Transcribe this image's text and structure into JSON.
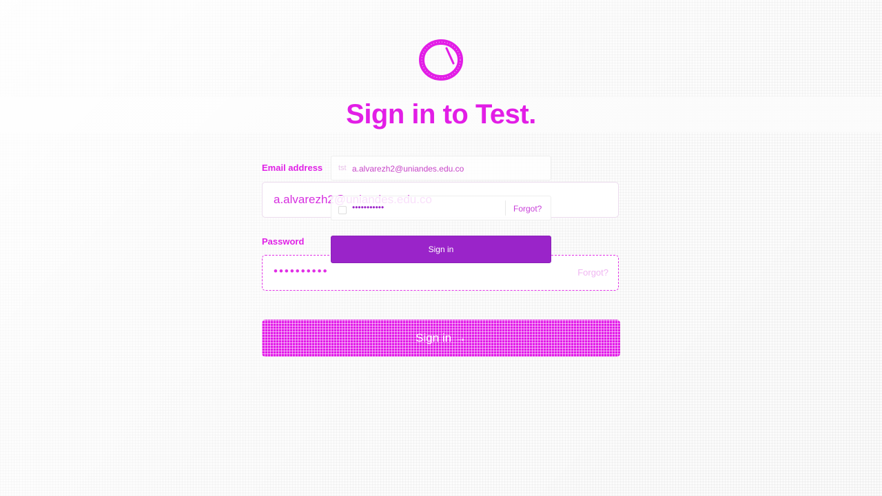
{
  "page": {
    "title": "Sign in to Test."
  },
  "form": {
    "email_label": "Email address",
    "email_value": "a.alvarezh2@uniandes.edu.co",
    "password_label": "Password",
    "password_mask": "••••••••••",
    "forgot_label": "Forgot?",
    "signin_label": "Sign in →"
  },
  "autofill_overlay": {
    "email_prefix": "tst",
    "email_value": "a.alvarezh2@uniandes.edu.co",
    "password_mask": "•••••••••••",
    "forgot_label": "Forgot?",
    "signin_label": "Sign in"
  },
  "icons": {
    "logo": "circle-logo-icon"
  },
  "colors": {
    "accent": "#e21ee6",
    "overlay_button": "#9a24c9",
    "forgot_text": "#f0b6f2"
  }
}
